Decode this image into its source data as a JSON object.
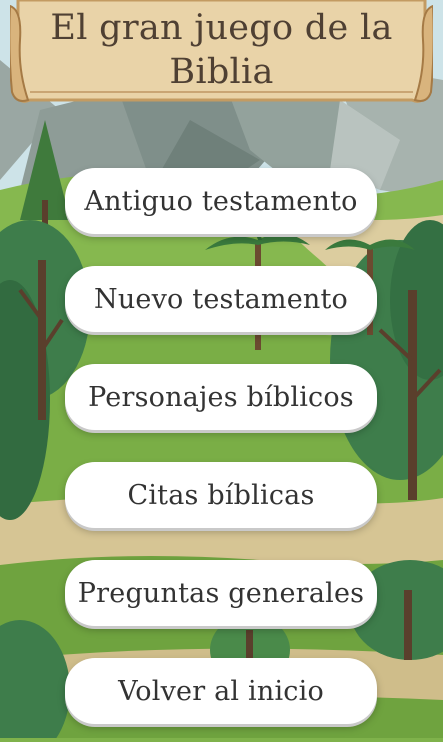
{
  "title": {
    "line1": "El gran juego de la",
    "line2": "Biblia"
  },
  "menu": [
    {
      "label": "Antiguo testamento"
    },
    {
      "label": "Nuevo testamento"
    },
    {
      "label": "Personajes bíblicos"
    },
    {
      "label": "Citas bíblicas"
    },
    {
      "label": "Preguntas generales"
    },
    {
      "label": "Volver al inicio"
    }
  ],
  "colors": {
    "sky": "#cde3e8",
    "grass": "#7fb24b",
    "path": "#d8c89a",
    "parchment": "#e9d3a8",
    "parchment_edge": "#c39b62",
    "title_text": "#4f4033",
    "button_bg": "#ffffff",
    "button_text": "#333333"
  },
  "icons": [
    "mountain-icon",
    "tree-icon",
    "palm-tree-icon",
    "scroll-banner-icon"
  ]
}
